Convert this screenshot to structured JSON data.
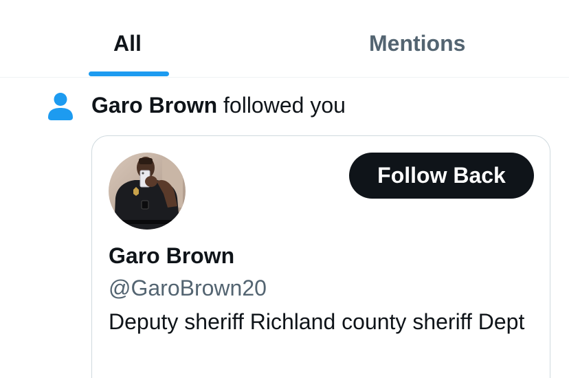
{
  "colors": {
    "accent": "#1d9bf0",
    "text_primary": "#0f1419",
    "text_secondary": "#536471",
    "button_bg": "#0f1419",
    "button_text": "#ffffff",
    "border": "#cfd9de"
  },
  "tabs": [
    {
      "label": "All",
      "selected": true
    },
    {
      "label": "Mentions",
      "selected": false
    }
  ],
  "notification": {
    "icon": "person-icon",
    "actor_name": "Garo Brown",
    "action_text": " followed you"
  },
  "user_card": {
    "avatar": "avatar-photo",
    "follow_button_label": "Follow Back",
    "display_name": "Garo Brown",
    "handle": "@GaroBrown20",
    "bio": "Deputy sheriff Richland county sheriff Dept"
  }
}
